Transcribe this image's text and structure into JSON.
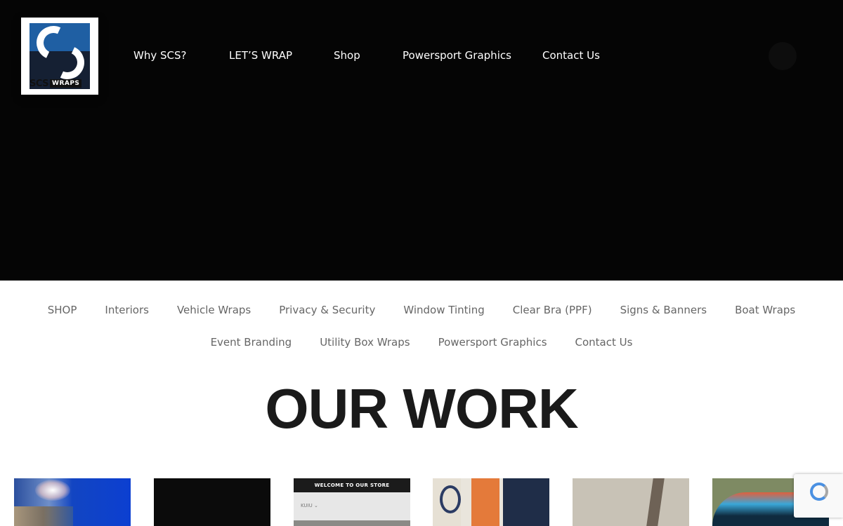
{
  "header": {
    "logo": {
      "text_main": "SCS",
      "text_sub": "WRAPS"
    },
    "nav": [
      {
        "label": "Why SCS?"
      },
      {
        "label": "LET’S WRAP"
      },
      {
        "label": "Shop"
      },
      {
        "label": "Powersport Graphics"
      },
      {
        "label": "Contact Us"
      }
    ]
  },
  "sub_nav": {
    "row1": [
      {
        "label": "SHOP"
      },
      {
        "label": "Interiors"
      },
      {
        "label": "Vehicle Wraps"
      },
      {
        "label": "Privacy & Security"
      },
      {
        "label": "Window Tinting"
      },
      {
        "label": "Clear Bra (PPF)"
      },
      {
        "label": "Signs & Banners"
      },
      {
        "label": "Boat Wraps"
      }
    ],
    "row2": [
      {
        "label": "Event Branding"
      },
      {
        "label": "Utility Box Wraps"
      },
      {
        "label": "Powersport Graphics"
      },
      {
        "label": "Contact Us"
      }
    ]
  },
  "section": {
    "title": "OUR WORK"
  },
  "gallery": {
    "store_thumb_banner": "WELCOME TO OUR STORE",
    "store_thumb_select": "KUIU ⌄"
  },
  "colors": {
    "header_bg": "#050505",
    "nav_text": "#ffffff",
    "subnav_text": "#666666",
    "title_text": "#1a1a1a",
    "logo_blue": "#1f5fa3"
  }
}
